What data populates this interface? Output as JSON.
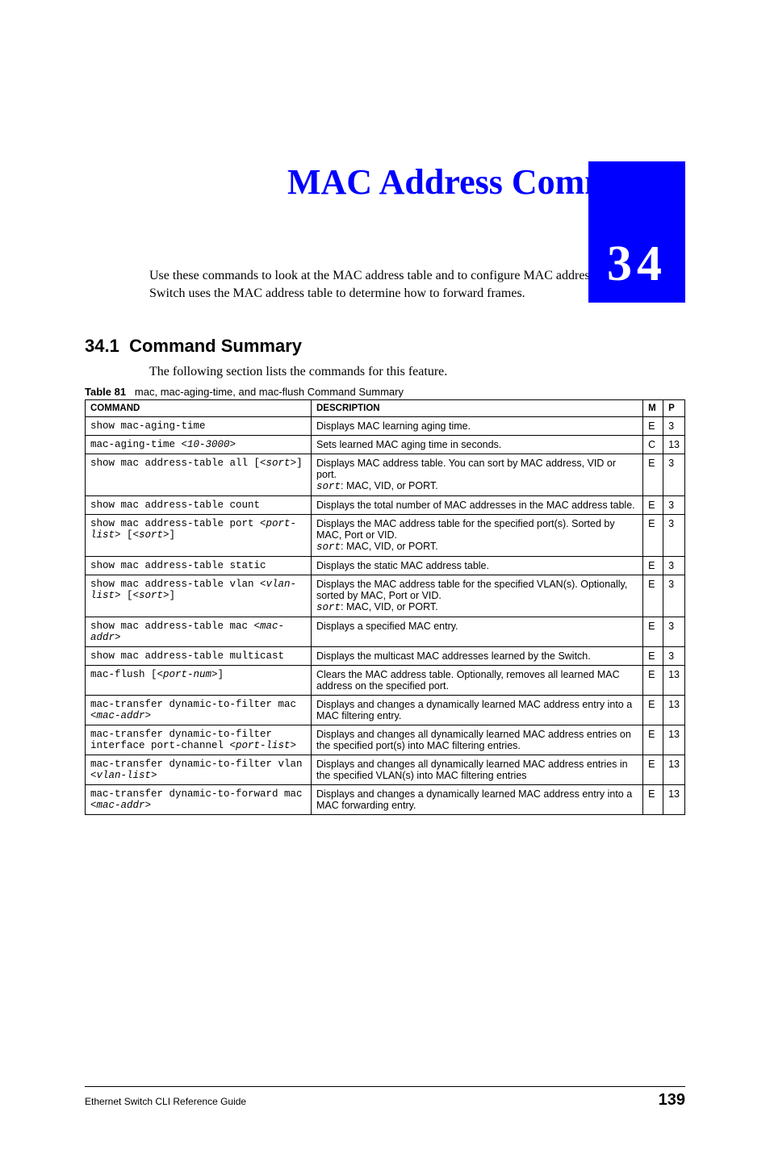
{
  "chapter_number": "34",
  "title": "MAC Address Commands",
  "intro": "Use these commands to look at the MAC address table and to configure MAC address learning. The Switch uses the MAC address table to determine how to forward frames.",
  "section": {
    "number": "34.1",
    "heading": "Command Summary",
    "intro": "The following section lists the commands for this feature."
  },
  "table": {
    "caption_label": "Table 81",
    "caption_text": "mac, mac-aging-time, and mac-flush Command Summary",
    "headers": [
      "COMMAND",
      "DESCRIPTION",
      "M",
      "P"
    ],
    "rows": [
      {
        "cmd": "show mac-aging-time",
        "desc": "Displays MAC learning aging time.",
        "m": "E",
        "p": "3"
      },
      {
        "cmd": "mac-aging-time <10-3000>",
        "desc": "Sets learned MAC aging time in seconds.",
        "m": "C",
        "p": "13"
      },
      {
        "cmd": "show mac address-table all [<sort>]",
        "desc": "Displays MAC address table. You can sort by MAC address, VID or port.",
        "desc2_mono": "sort",
        "desc2_rest": ": MAC, VID, or PORT.",
        "m": "E",
        "p": "3"
      },
      {
        "cmd": "show mac address-table count",
        "desc": "Displays the total number of MAC addresses in the MAC address table.",
        "m": "E",
        "p": "3"
      },
      {
        "cmd": "show mac address-table port <port-list> [<sort>]",
        "desc": "Displays the MAC address table for the specified port(s). Sorted by MAC, Port or VID.",
        "desc2_mono": "sort",
        "desc2_rest": ": MAC, VID, or PORT.",
        "m": "E",
        "p": "3"
      },
      {
        "cmd": "show mac address-table static",
        "desc": "Displays the static MAC address table.",
        "m": "E",
        "p": "3"
      },
      {
        "cmd": "show mac address-table vlan <vlan-list> [<sort>]",
        "desc": "Displays the MAC address table for the specified VLAN(s). Optionally, sorted by MAC, Port or VID.",
        "desc2_mono": "sort",
        "desc2_rest": ": MAC, VID, or PORT.",
        "m": "E",
        "p": "3"
      },
      {
        "cmd": "show mac address-table mac <mac-addr>",
        "desc": "Displays a specified MAC entry.",
        "m": "E",
        "p": "3"
      },
      {
        "cmd": "show mac address-table multicast",
        "desc": "Displays the multicast MAC addresses learned by the Switch.",
        "m": "E",
        "p": "3"
      },
      {
        "cmd": "mac-flush [<port-num>]",
        "desc": "Clears the MAC address table. Optionally, removes all learned MAC address on the specified port.",
        "m": "E",
        "p": "13"
      },
      {
        "cmd": "mac-transfer dynamic-to-filter mac <mac-addr>",
        "desc": "Displays and changes a dynamically learned MAC address entry into a MAC filtering entry.",
        "m": "E",
        "p": "13"
      },
      {
        "cmd": "mac-transfer dynamic-to-filter interface port-channel <port-list>",
        "desc": "Displays and changes all dynamically learned MAC address entries on the specified port(s) into MAC filtering entries.",
        "m": "E",
        "p": "13"
      },
      {
        "cmd": "mac-transfer dynamic-to-filter vlan <vlan-list>",
        "desc": "Displays and changes all dynamically learned MAC address entries in the specified VLAN(s) into MAC filtering entries",
        "m": "E",
        "p": "13"
      },
      {
        "cmd": "mac-transfer dynamic-to-forward mac <mac-addr>",
        "desc": "Displays and changes a dynamically learned MAC address entry into a MAC forwarding entry.",
        "m": "E",
        "p": "13"
      }
    ]
  },
  "footer": {
    "book": "Ethernet Switch CLI Reference Guide",
    "page": "139"
  }
}
